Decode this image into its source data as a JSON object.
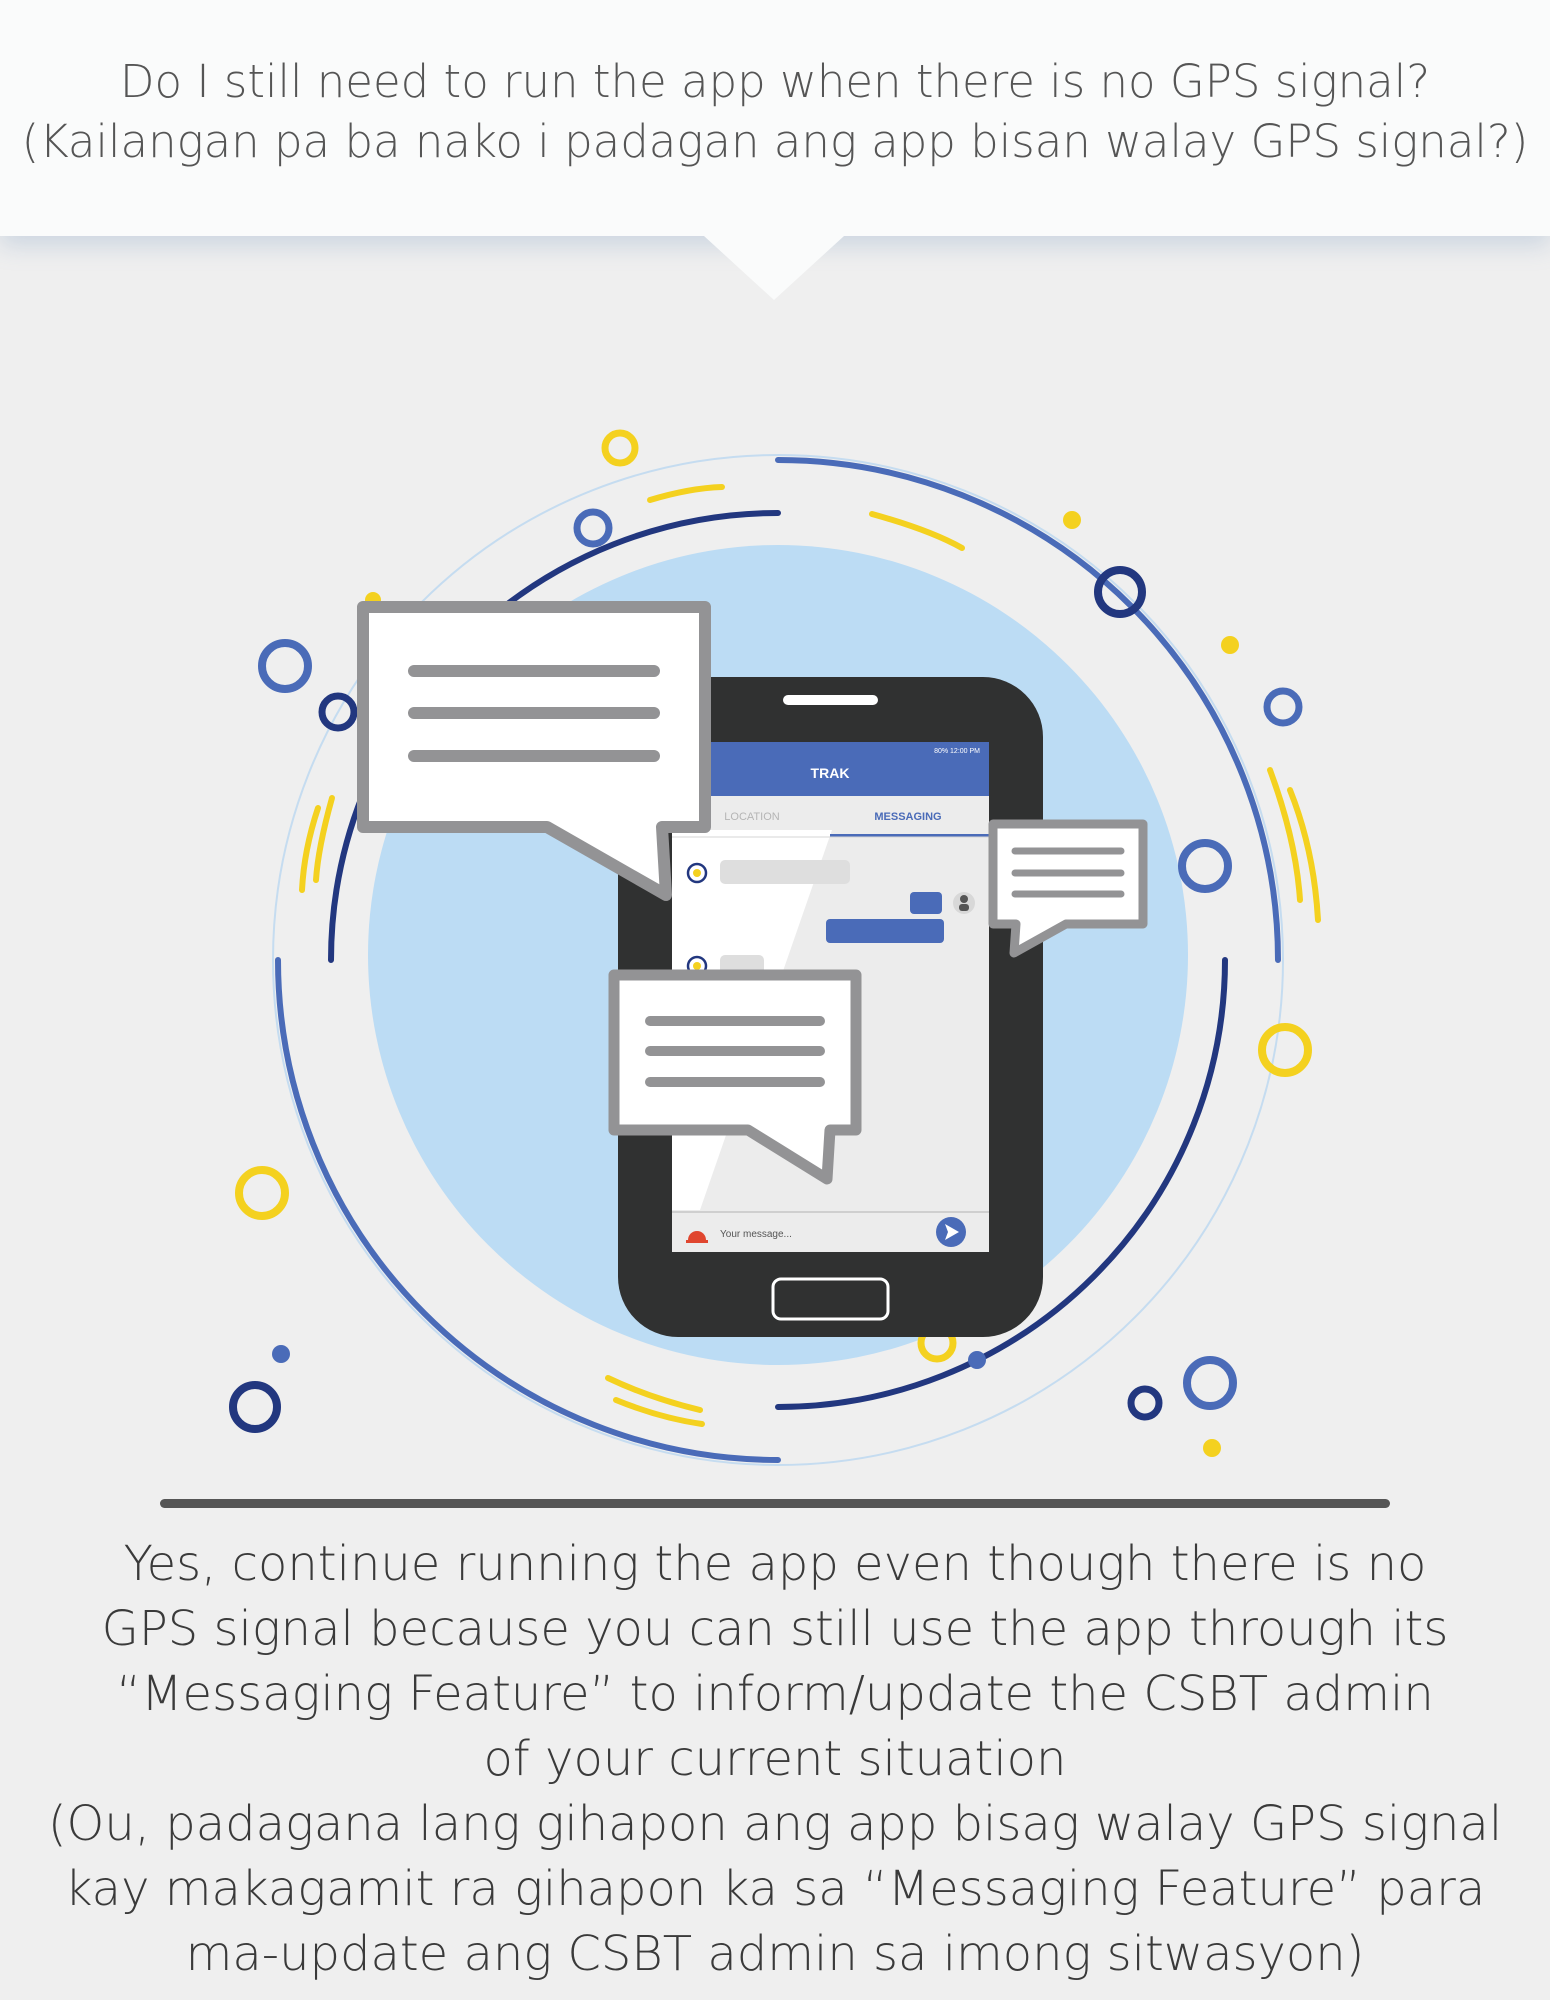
{
  "question": {
    "line1": "Do I still need to run the app when there is no GPS signal?",
    "line2": "(Kailangan pa ba nako i padagan ang app bisan walay GPS signal?)"
  },
  "phone": {
    "app_title": "TRAK",
    "status_bar": "80%  12:00 PM",
    "tabs": {
      "location": "LOCATION",
      "messaging": "MESSAGING"
    },
    "message_placeholder": "Your message..."
  },
  "answer": {
    "lines": [
      "Yes, continue running the app even though there is no",
      "GPS signal because you can still use the app through its",
      "“Messaging Feature” to inform/update the CSBT admin",
      "of your current situation",
      "(Ou, padagana lang gihapon ang app bisag walay GPS signal",
      "kay makagamit ra gihapon ka sa “Messaging Feature” para",
      "ma-update ang CSBT admin sa imong sitwasyon)"
    ]
  },
  "colors": {
    "navy": "#22377f",
    "blue": "#4a6bb8",
    "yellow": "#f4d11f",
    "light_blue": "#bcdcf4",
    "phone_body": "#303131",
    "bubble_border": "#939395"
  }
}
